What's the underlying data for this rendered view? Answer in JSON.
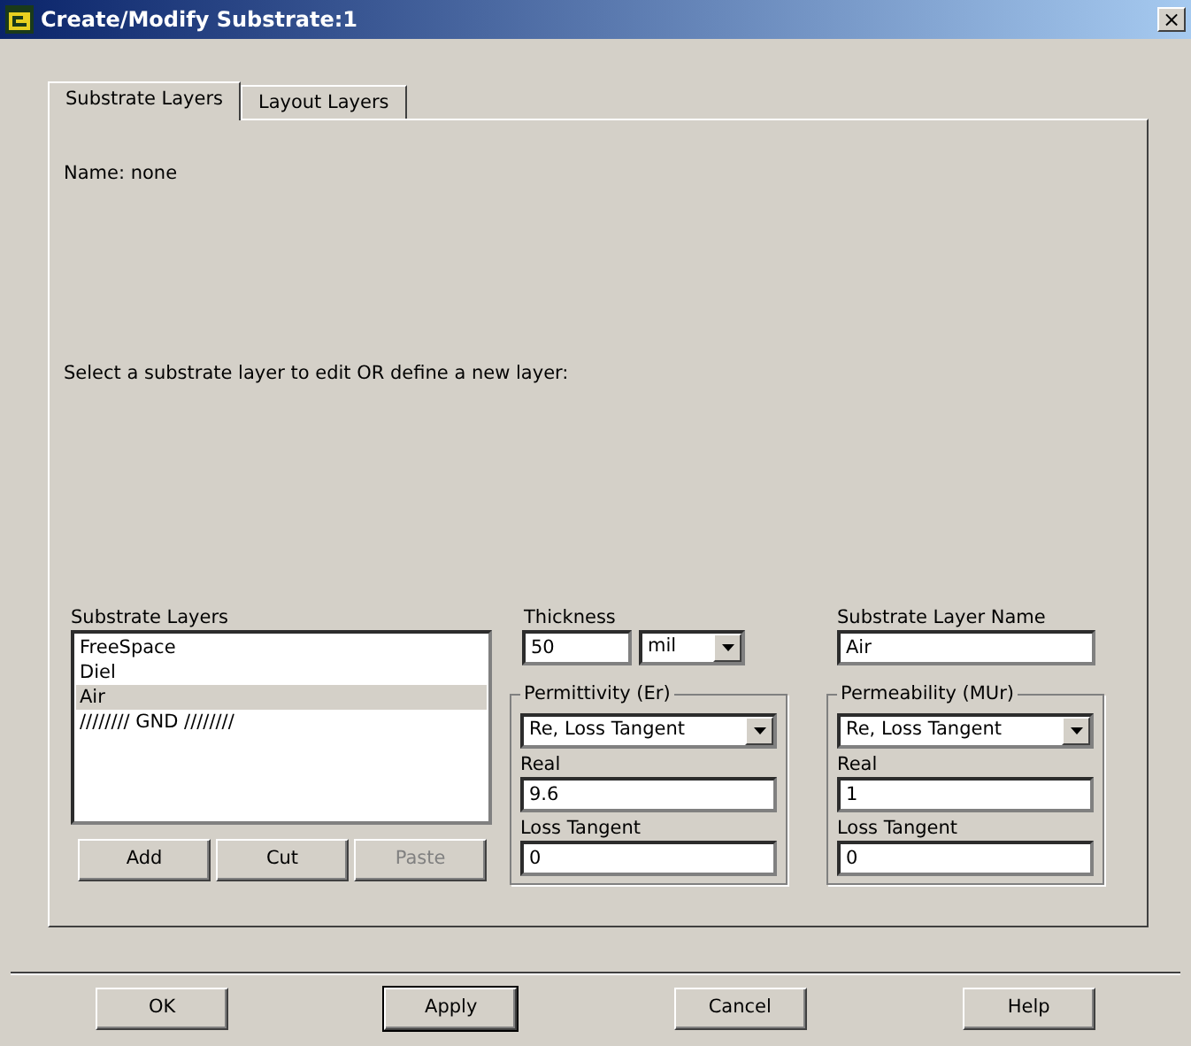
{
  "window": {
    "title": "Create/Modify Substrate:1",
    "close": "×"
  },
  "tabs": [
    {
      "label": "Substrate Layers",
      "selected": true
    },
    {
      "label": "Layout Layers",
      "selected": false
    }
  ],
  "name_text": "Name: none",
  "instruction": "Select a substrate layer to edit OR define a new layer:",
  "layers": {
    "label": "Substrate Layers",
    "items": [
      {
        "label": "FreeSpace",
        "selected": false
      },
      {
        "label": "Diel",
        "selected": false
      },
      {
        "label": "Air",
        "selected": true
      },
      {
        "label": "//////// GND ////////",
        "selected": false
      }
    ],
    "buttons": [
      {
        "label": "Add",
        "disabled": false
      },
      {
        "label": "Cut",
        "disabled": false
      },
      {
        "label": "Paste",
        "disabled": true
      }
    ]
  },
  "thickness": {
    "label": "Thickness",
    "value": "50",
    "unit": "mil"
  },
  "layer_name": {
    "label": "Substrate Layer Name",
    "value": "Air"
  },
  "groups": [
    {
      "title": "Permittivity (Er)",
      "mode": "Re, Loss Tangent",
      "real_label": "Real",
      "real": "9.6",
      "loss_label": "Loss Tangent",
      "loss": "0"
    },
    {
      "title": "Permeability (MUr)",
      "mode": "Re, Loss Tangent",
      "real_label": "Real",
      "real": "1",
      "loss_label": "Loss Tangent",
      "loss": "0"
    }
  ],
  "dialog_buttons": [
    {
      "label": "OK",
      "default": false
    },
    {
      "label": "Apply",
      "default": true
    },
    {
      "label": "Cancel",
      "default": false
    },
    {
      "label": "Help",
      "default": false
    }
  ]
}
